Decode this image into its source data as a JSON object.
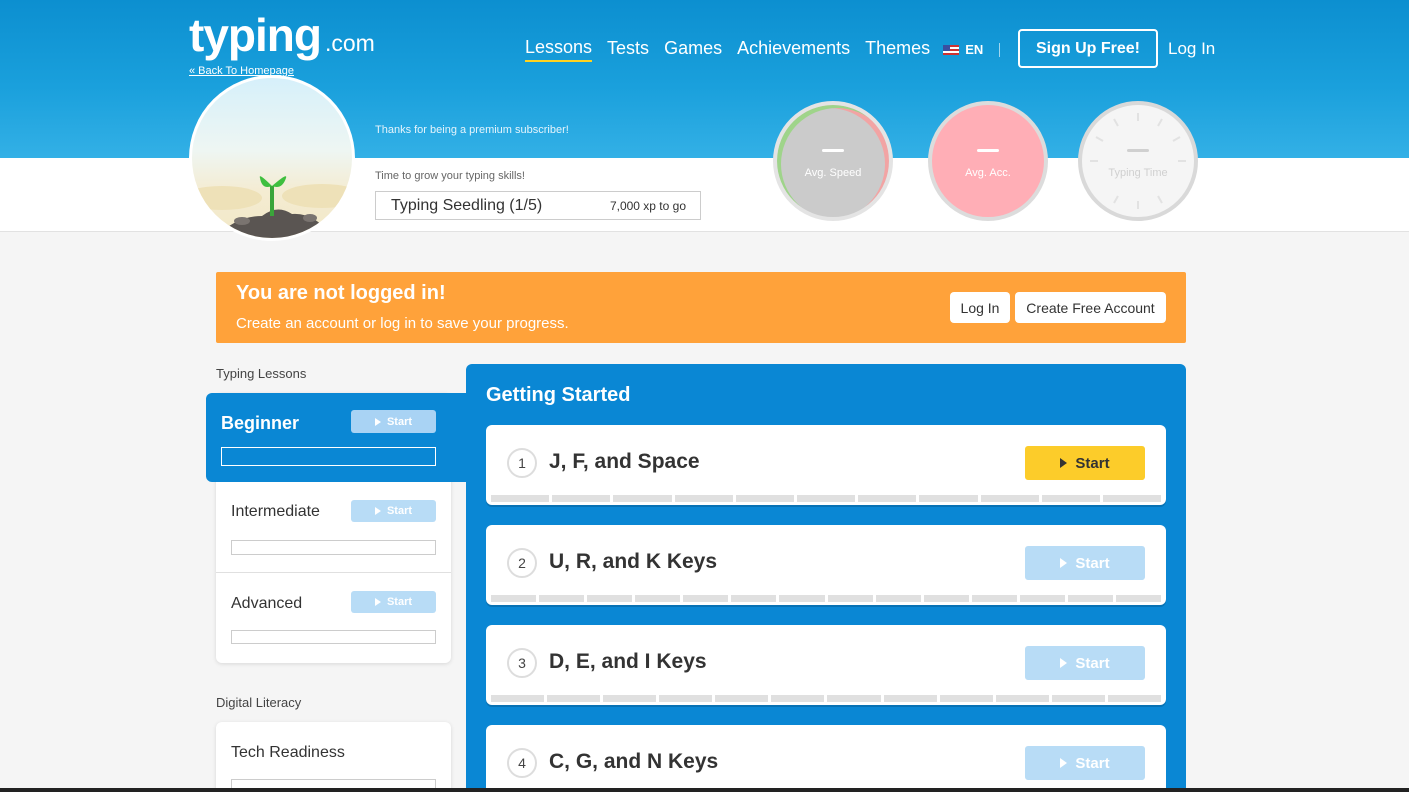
{
  "header": {
    "logo_main": "typing",
    "logo_suffix": ".com",
    "back_link": "« Back To Homepage",
    "nav": [
      "Lessons",
      "Tests",
      "Games",
      "Achievements",
      "Themes"
    ],
    "language": "EN",
    "signup_label": "Sign Up Free!",
    "login_label": "Log In"
  },
  "profile": {
    "thanks_text": "Thanks for being a premium subscriber!",
    "grow_text": "Time to grow your typing skills!",
    "level": "Typing Seedling (1/5)",
    "xp_to_go": "7,000 xp to go"
  },
  "stats": [
    {
      "value": "—",
      "label": "Avg. Speed"
    },
    {
      "value": "—",
      "label": "Avg. Acc."
    },
    {
      "value": "—",
      "label": "Typing Time"
    }
  ],
  "banner": {
    "title": "You are not logged in!",
    "subtitle": "Create an account or log in to save your progress.",
    "login_label": "Log In",
    "create_label": "Create Free Account"
  },
  "sidebar": {
    "section_lessons": "Typing Lessons",
    "levels": [
      {
        "name": "Beginner",
        "start": "Start"
      },
      {
        "name": "Intermediate",
        "start": "Start"
      },
      {
        "name": "Advanced",
        "start": "Start"
      }
    ],
    "section_literacy": "Digital Literacy",
    "literacy_items": [
      {
        "name": "Tech Readiness"
      }
    ]
  },
  "main": {
    "title": "Getting Started",
    "lessons": [
      {
        "number": "1",
        "name": "J, F, and Space",
        "start": "Start"
      },
      {
        "number": "2",
        "name": "U, R, and K Keys",
        "start": "Start"
      },
      {
        "number": "3",
        "name": "D, E, and I Keys",
        "start": "Start"
      },
      {
        "number": "4",
        "name": "C, G, and N Keys",
        "start": "Start"
      }
    ]
  },
  "colors": {
    "header_blue": "#0c8fd0",
    "panel_blue": "#0a87d4",
    "banner_orange": "#ffa23a",
    "active_start": "#fccc2a",
    "inactive_start": "#b8dcf6"
  }
}
